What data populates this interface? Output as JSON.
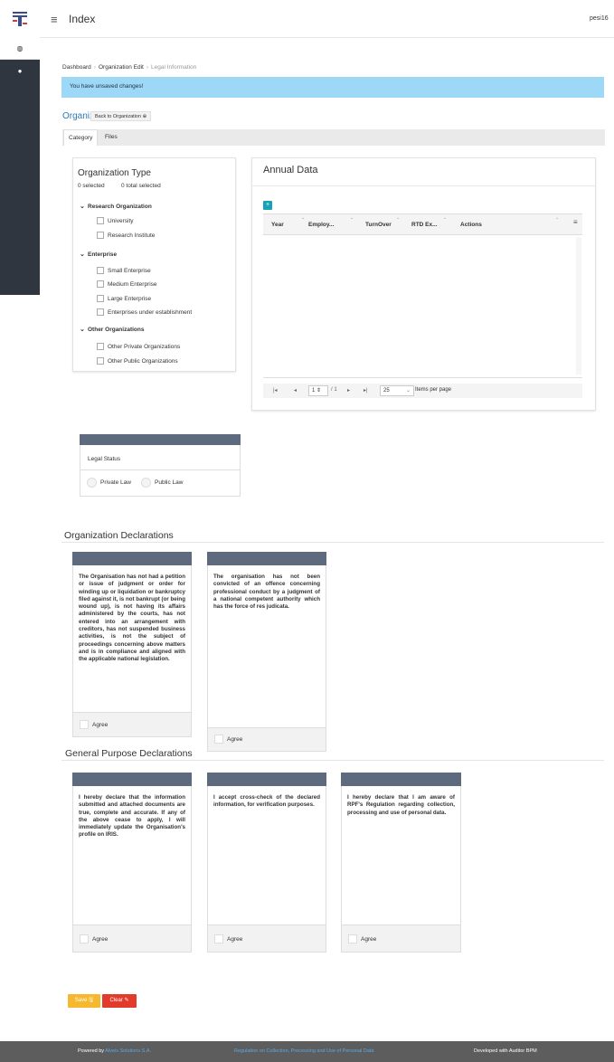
{
  "header": {
    "title": "Index",
    "user": "pesi16"
  },
  "sidebar": {
    "items": [
      {
        "icon": "dashboard-icon"
      },
      {
        "icon": "user-icon"
      }
    ]
  },
  "breadcrumb": {
    "items": [
      "Dashboard",
      "Organization Edit",
      "Legal Information"
    ]
  },
  "alert": {
    "text": "You have unsaved changes!"
  },
  "org_header": {
    "label": "Organization :",
    "back_label": "Back to Organization ⊕"
  },
  "tabs": [
    {
      "label": "Category",
      "active": true
    },
    {
      "label": "Files",
      "active": false
    }
  ],
  "org_type": {
    "title": "Organization Type",
    "selected": "0 selected",
    "total_selected": "0 total selected",
    "groups": [
      {
        "label": "Research Organization",
        "options": [
          "University",
          "Research Institute"
        ]
      },
      {
        "label": "Enterprise",
        "options": [
          "Small Enterprise",
          "Medium Enterprise",
          "Large Enterprise",
          "Enterprises under establishment"
        ]
      },
      {
        "label": "Other Organizations",
        "options": [
          "Other Private Organizations",
          "Other Public Organizations"
        ]
      }
    ]
  },
  "annual_data": {
    "title": "Annual Data",
    "columns": [
      "Year",
      "Employ...",
      "TurnOver",
      "RTD Ex...",
      "Actions"
    ],
    "pager": {
      "page": "1",
      "of": "/ 1",
      "page_size": "25",
      "items_per_page": "Items per page"
    }
  },
  "legal_status": {
    "label": "Legal Status",
    "options": [
      "Private Law",
      "Public Law"
    ]
  },
  "org_declarations": {
    "title": "Organization Declarations",
    "items": [
      {
        "text": "The Organisation has not had a petition or issue of judgment or order for winding up or liquidation or bankruptcy filed against it, is not bankrupt (or being wound up), is not having its affairs administered by the courts, has not entered into an arrangement with creditors, has not suspended business activities, is not the subject of proceedings concerning above matters and is in compliance and aligned with the applicable national legislation.",
        "agree": "Agree"
      },
      {
        "text": "The organisation has not been convicted of an offence concerning professional conduct by a judgment of a national competent authority which has the force of res judicata.",
        "agree": "Agree"
      }
    ]
  },
  "gp_declarations": {
    "title": "General Purpose Declarations",
    "items": [
      {
        "text": "I hereby declare that the information submitted and attached documents are true, complete and accurate. If any of the above cease to apply, I will immediately update the Organisation's profile on IRIS.",
        "agree": "Agree"
      },
      {
        "text": "I accept cross-check of the declared information, for verification purposes.",
        "agree": "Agree"
      },
      {
        "text": "I hereby declare that I am aware of RPF's Regulation regarding collection, processing and use of personal data.",
        "agree": "Agree"
      }
    ]
  },
  "actions": {
    "save": "Save 🖫",
    "clear": "Clear ✎"
  },
  "footer": {
    "powered_by": "Powered by",
    "company": "Alveis Solutions S.A.",
    "regulation": "Regulation on Collection, Processing and Use of Personal Data",
    "developed": "Developed with Auditor BPM"
  },
  "colors": {
    "sidebar": "#2f3640",
    "alert": "#9ed8f7",
    "card_header": "#5e6a7d",
    "link": "#2f79b5",
    "save": "#f5b82e",
    "clear": "#e23a2b",
    "footer": "#5d5d5d",
    "add": "#17a2b8"
  }
}
